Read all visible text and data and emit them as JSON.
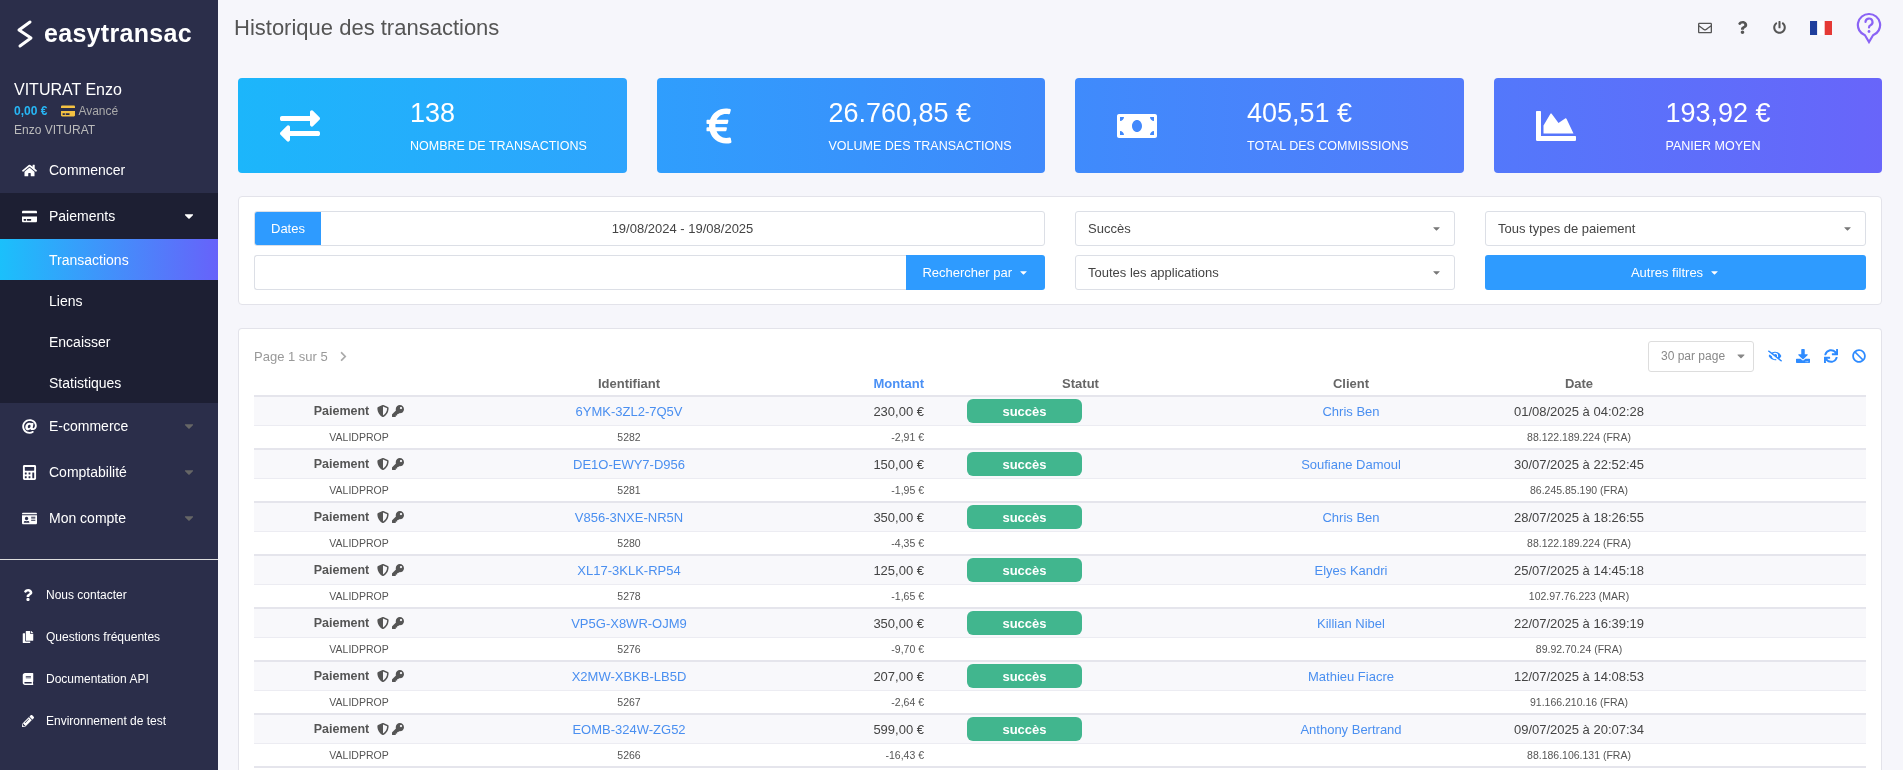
{
  "sidebar": {
    "brand": "easytransac",
    "user": {
      "name": "VITURAT Enzo",
      "balance": "0,00 €",
      "plan": "Avancé",
      "login": "Enzo VITURAT"
    },
    "nav": [
      {
        "label": "Commencer",
        "kind": "link"
      },
      {
        "label": "Paiements",
        "kind": "group",
        "expanded": true,
        "children": [
          {
            "label": "Transactions",
            "selected": true
          },
          {
            "label": "Liens",
            "selected": false
          },
          {
            "label": "Encaisser",
            "selected": false
          },
          {
            "label": "Statistiques",
            "selected": false
          }
        ]
      },
      {
        "label": "E-commerce",
        "kind": "group",
        "expanded": false
      },
      {
        "label": "Comptabilité",
        "kind": "group",
        "expanded": false
      },
      {
        "label": "Mon compte",
        "kind": "group",
        "expanded": false
      }
    ],
    "footer_links": [
      "Nous contacter",
      "Questions fréquentes",
      "Documentation API",
      "Environnement de test"
    ]
  },
  "header": {
    "title": "Historique des transactions"
  },
  "stats": [
    {
      "value": "138",
      "label": "NOMBRE DE TRANSACTIONS"
    },
    {
      "value": "26.760,85 €",
      "label": "VOLUME DES TRANSACTIONS"
    },
    {
      "value": "405,51 €",
      "label": "TOTAL DES COMMISSIONS"
    },
    {
      "value": "193,92 €",
      "label": "PANIER MOYEN"
    }
  ],
  "filters": {
    "dates_button": "Dates",
    "date_range": "19/08/2024 - 19/08/2025",
    "search_button": "Rechercher par",
    "status_select": "Succès",
    "apps_select": "Toutes les applications",
    "payment_type_select": "Tous types de paiement",
    "more_filters": "Autres filtres"
  },
  "table": {
    "pagination": "Page 1 sur 5",
    "per_page": "30 par page",
    "columns": [
      {
        "label": "Identifiant",
        "sorted": false
      },
      {
        "label": "Montant",
        "sorted": true
      },
      {
        "label": "Statut",
        "sorted": false
      },
      {
        "label": "Client",
        "sorted": false
      },
      {
        "label": "Date",
        "sorted": false
      }
    ],
    "rows": [
      {
        "type": "Paiement",
        "subtype": "VALIDPROP",
        "id": "6YMK-3ZL2-7Q5V",
        "number": "5282",
        "amount": "230,00 €",
        "fee": "-2,91 €",
        "status": "succès",
        "client": "Chris Ben",
        "date": "01/08/2025 à 04:02:28",
        "ip": "88.122.189.224 (FRA)"
      },
      {
        "type": "Paiement",
        "subtype": "VALIDPROP",
        "id": "DE1O-EWY7-D956",
        "number": "5281",
        "amount": "150,00 €",
        "fee": "-1,95 €",
        "status": "succès",
        "client": "Soufiane Damoul",
        "date": "30/07/2025 à 22:52:45",
        "ip": "86.245.85.190 (FRA)"
      },
      {
        "type": "Paiement",
        "subtype": "VALIDPROP",
        "id": "V856-3NXE-NR5N",
        "number": "5280",
        "amount": "350,00 €",
        "fee": "-4,35 €",
        "status": "succès",
        "client": "Chris Ben",
        "date": "28/07/2025 à 18:26:55",
        "ip": "88.122.189.224 (FRA)"
      },
      {
        "type": "Paiement",
        "subtype": "VALIDPROP",
        "id": "XL17-3KLK-RP54",
        "number": "5278",
        "amount": "125,00 €",
        "fee": "-1,65 €",
        "status": "succès",
        "client": "Elyes Kandri",
        "date": "25/07/2025 à 14:45:18",
        "ip": "102.97.76.223 (MAR)"
      },
      {
        "type": "Paiement",
        "subtype": "VALIDPROP",
        "id": "VP5G-X8WR-OJM9",
        "number": "5276",
        "amount": "350,00 €",
        "fee": "-9,70 €",
        "status": "succès",
        "client": "Killian Nibel",
        "date": "22/07/2025 à 16:39:19",
        "ip": "89.92.70.24 (FRA)"
      },
      {
        "type": "Paiement",
        "subtype": "VALIDPROP",
        "id": "X2MW-XBKB-LB5D",
        "number": "5267",
        "amount": "207,00 €",
        "fee": "-2,64 €",
        "status": "succès",
        "client": "Mathieu Fiacre",
        "date": "12/07/2025 à 14:08:53",
        "ip": "91.166.210.16 (FRA)"
      },
      {
        "type": "Paiement",
        "subtype": "VALIDPROP",
        "id": "EOMB-324W-ZG52",
        "number": "5266",
        "amount": "599,00 €",
        "fee": "-16,43 €",
        "status": "succès",
        "client": "Anthony Bertrand",
        "date": "09/07/2025 à 20:07:34",
        "ip": "88.186.106.131 (FRA)"
      }
    ]
  }
}
